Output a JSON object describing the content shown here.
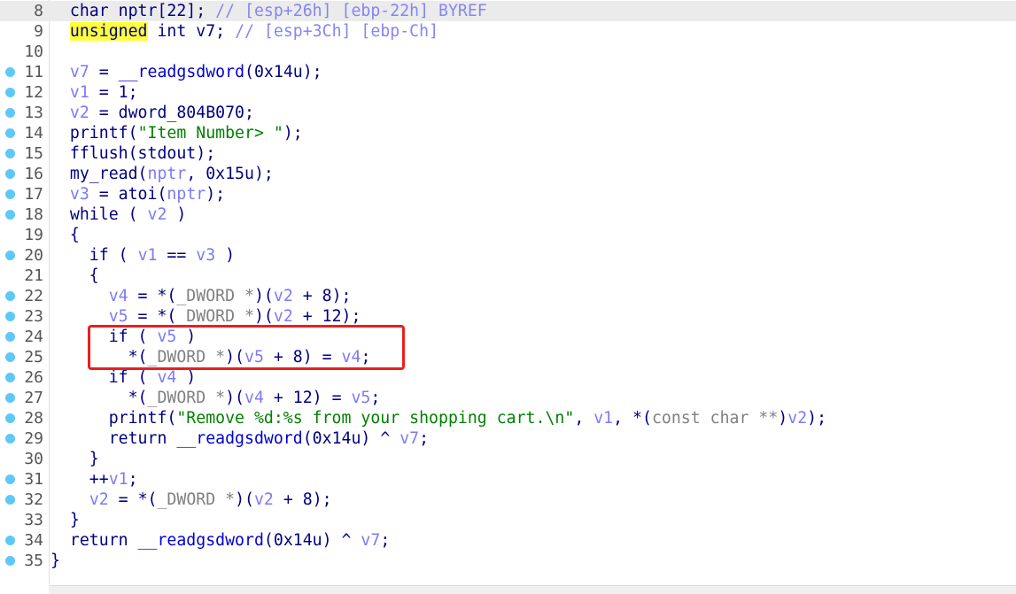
{
  "colors": {
    "keyword": "#000080",
    "variable": "#7b7bf5",
    "type": "#808080",
    "string": "#008000",
    "comment": "#8585f5",
    "highlight": "#ffff3c",
    "breakpoint_dot": "#5ec8f8",
    "annotation_box": "#e82020"
  },
  "current_line": 8,
  "lines": [
    {
      "n": "8",
      "dot": false,
      "tokens": [
        [
          "k",
          "  char nptr[22]; "
        ],
        [
          "c",
          "// [esp+26h] [ebp-22h] BYREF"
        ]
      ]
    },
    {
      "n": "9",
      "dot": false,
      "tokens": [
        [
          "k",
          "  "
        ],
        [
          "k hl",
          "unsigned"
        ],
        [
          "k",
          " int v7; "
        ],
        [
          "c",
          "// [esp+3Ch] [ebp-Ch]"
        ]
      ]
    },
    {
      "n": "10",
      "dot": false,
      "tokens": []
    },
    {
      "n": "11",
      "dot": true,
      "tokens": [
        [
          "k",
          "  "
        ],
        [
          "v",
          "v7"
        ],
        [
          "k",
          " = "
        ],
        [
          "f",
          "__readgsdword"
        ],
        [
          "k",
          "(0x14u);"
        ]
      ]
    },
    {
      "n": "12",
      "dot": true,
      "tokens": [
        [
          "k",
          "  "
        ],
        [
          "v",
          "v1"
        ],
        [
          "k",
          " = 1;"
        ]
      ]
    },
    {
      "n": "13",
      "dot": true,
      "tokens": [
        [
          "k",
          "  "
        ],
        [
          "v",
          "v2"
        ],
        [
          "k",
          " = dword_804B070;"
        ]
      ]
    },
    {
      "n": "14",
      "dot": true,
      "tokens": [
        [
          "k",
          "  printf("
        ],
        [
          "s",
          "\"Item Number> \""
        ],
        [
          "k",
          ");"
        ]
      ]
    },
    {
      "n": "15",
      "dot": true,
      "tokens": [
        [
          "k",
          "  fflush(stdout);"
        ]
      ]
    },
    {
      "n": "16",
      "dot": true,
      "tokens": [
        [
          "k",
          "  my_read("
        ],
        [
          "v",
          "nptr"
        ],
        [
          "k",
          ", 0x15u);"
        ]
      ]
    },
    {
      "n": "17",
      "dot": true,
      "tokens": [
        [
          "k",
          "  "
        ],
        [
          "v",
          "v3"
        ],
        [
          "k",
          " = atoi("
        ],
        [
          "v",
          "nptr"
        ],
        [
          "k",
          ");"
        ]
      ]
    },
    {
      "n": "18",
      "dot": true,
      "tokens": [
        [
          "k",
          "  while ( "
        ],
        [
          "v",
          "v2"
        ],
        [
          "k",
          " )"
        ]
      ]
    },
    {
      "n": "19",
      "dot": false,
      "tokens": [
        [
          "k",
          "  {"
        ]
      ]
    },
    {
      "n": "20",
      "dot": true,
      "tokens": [
        [
          "k",
          "    if ( "
        ],
        [
          "v",
          "v1"
        ],
        [
          "k",
          " == "
        ],
        [
          "v",
          "v3"
        ],
        [
          "k",
          " )"
        ]
      ]
    },
    {
      "n": "21",
      "dot": false,
      "tokens": [
        [
          "k",
          "    {"
        ]
      ]
    },
    {
      "n": "22",
      "dot": true,
      "tokens": [
        [
          "k",
          "      "
        ],
        [
          "v",
          "v4"
        ],
        [
          "k",
          " = *("
        ],
        [
          "t",
          "_DWORD *"
        ],
        [
          "k",
          ")("
        ],
        [
          "v",
          "v2"
        ],
        [
          "k",
          " + 8);"
        ]
      ]
    },
    {
      "n": "23",
      "dot": true,
      "tokens": [
        [
          "k",
          "      "
        ],
        [
          "v",
          "v5"
        ],
        [
          "k",
          " = *("
        ],
        [
          "t",
          "_DWORD *"
        ],
        [
          "k",
          ")("
        ],
        [
          "v",
          "v2"
        ],
        [
          "k",
          " + 12);"
        ]
      ]
    },
    {
      "n": "24",
      "dot": true,
      "tokens": [
        [
          "k",
          "      if ( "
        ],
        [
          "v",
          "v5"
        ],
        [
          "k",
          " )"
        ]
      ]
    },
    {
      "n": "25",
      "dot": true,
      "tokens": [
        [
          "k",
          "        *("
        ],
        [
          "t",
          "_DWORD *"
        ],
        [
          "k",
          ")("
        ],
        [
          "v",
          "v5"
        ],
        [
          "k",
          " + 8) = "
        ],
        [
          "v",
          "v4"
        ],
        [
          "k",
          ";"
        ]
      ]
    },
    {
      "n": "26",
      "dot": true,
      "tokens": [
        [
          "k",
          "      if ( "
        ],
        [
          "v",
          "v4"
        ],
        [
          "k",
          " )"
        ]
      ]
    },
    {
      "n": "27",
      "dot": true,
      "tokens": [
        [
          "k",
          "        *("
        ],
        [
          "t",
          "_DWORD *"
        ],
        [
          "k",
          ")("
        ],
        [
          "v",
          "v4"
        ],
        [
          "k",
          " + 12) = "
        ],
        [
          "v",
          "v5"
        ],
        [
          "k",
          ";"
        ]
      ]
    },
    {
      "n": "28",
      "dot": true,
      "tokens": [
        [
          "k",
          "      printf("
        ],
        [
          "s",
          "\"Remove %d:%s from your shopping cart.\\n\""
        ],
        [
          "k",
          ", "
        ],
        [
          "v",
          "v1"
        ],
        [
          "k",
          ", *("
        ],
        [
          "t",
          "const char **"
        ],
        [
          "k",
          ")"
        ],
        [
          "v",
          "v2"
        ],
        [
          "k",
          ");"
        ]
      ]
    },
    {
      "n": "29",
      "dot": true,
      "tokens": [
        [
          "k",
          "      return "
        ],
        [
          "f",
          "__readgsdword"
        ],
        [
          "k",
          "(0x14u) ^ "
        ],
        [
          "v",
          "v7"
        ],
        [
          "k",
          ";"
        ]
      ]
    },
    {
      "n": "30",
      "dot": false,
      "tokens": [
        [
          "k",
          "    }"
        ]
      ]
    },
    {
      "n": "31",
      "dot": true,
      "tokens": [
        [
          "k",
          "    ++"
        ],
        [
          "v",
          "v1"
        ],
        [
          "k",
          ";"
        ]
      ]
    },
    {
      "n": "32",
      "dot": true,
      "tokens": [
        [
          "k",
          "    "
        ],
        [
          "v",
          "v2"
        ],
        [
          "k",
          " = *("
        ],
        [
          "t",
          "_DWORD *"
        ],
        [
          "k",
          ")("
        ],
        [
          "v",
          "v2"
        ],
        [
          "k",
          " + 8);"
        ]
      ]
    },
    {
      "n": "33",
      "dot": false,
      "tokens": [
        [
          "k",
          "  }"
        ]
      ]
    },
    {
      "n": "34",
      "dot": true,
      "tokens": [
        [
          "k",
          "  return "
        ],
        [
          "f",
          "__readgsdword"
        ],
        [
          "k",
          "(0x14u) ^ "
        ],
        [
          "v",
          "v7"
        ],
        [
          "k",
          ";"
        ]
      ]
    },
    {
      "n": "35",
      "dot": true,
      "tokens": [
        [
          "k",
          "}"
        ]
      ]
    }
  ]
}
